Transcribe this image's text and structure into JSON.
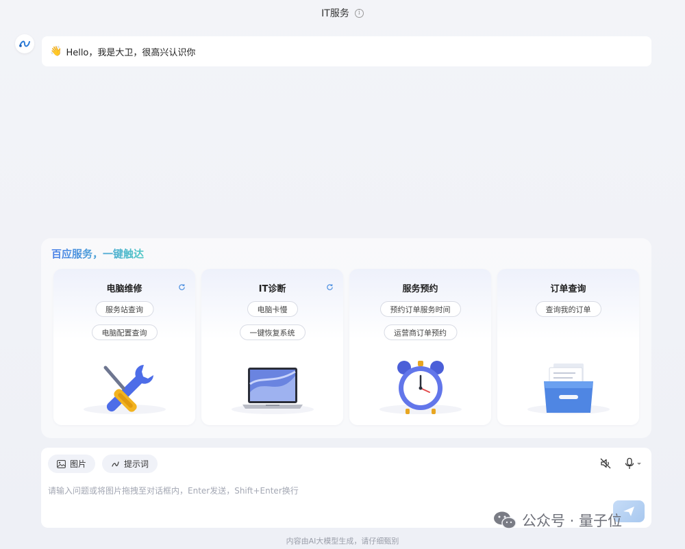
{
  "header": {
    "title": "IT服务",
    "info_icon": "info-icon"
  },
  "chat": {
    "bot_avatar_icon": "infinity-logo-icon",
    "greeting_emoji": "👋",
    "greeting_text": "Hello，我是大卫，很高兴认识你"
  },
  "services": {
    "title": "百应服务，一键触达",
    "title_gradient": [
      "#4a7fe8",
      "#4fc7c4"
    ],
    "cards": [
      {
        "title": "电脑维修",
        "chips": [
          "服务站查询",
          "电脑配置查询"
        ],
        "illustration": "tools-icon",
        "refresh": true
      },
      {
        "title": "IT诊断",
        "chips": [
          "电脑卡慢",
          "一键恢复系统"
        ],
        "illustration": "laptop-icon",
        "refresh": true
      },
      {
        "title": "服务预约",
        "chips": [
          "预约订单服务时间",
          "运营商订单预约"
        ],
        "illustration": "alarm-clock-icon",
        "refresh": false
      },
      {
        "title": "订单查询",
        "chips": [
          "查询我的订单"
        ],
        "illustration": "file-box-icon",
        "refresh": false
      }
    ]
  },
  "composer": {
    "image_button": "图片",
    "prompt_button": "提示词",
    "placeholder": "请输入问题或将图片拖拽至对话框内，Enter发送，Shift+Enter换行",
    "mute_icon": "speaker-off-icon",
    "mic_icon": "microphone-icon",
    "send_icon": "send-icon"
  },
  "footer": {
    "disclaimer": "内容由AI大模型生成，请仔细甄别"
  },
  "watermark": {
    "text": "公众号 · 量子位"
  }
}
